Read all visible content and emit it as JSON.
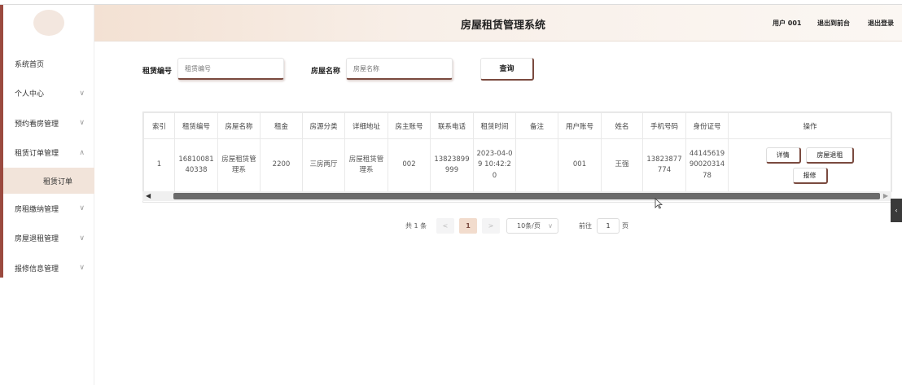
{
  "header": {
    "title": "房屋租赁管理系统",
    "user": "用户 001",
    "back_link": "退出到前台",
    "logout_link": "退出登录"
  },
  "sidebar": {
    "items": [
      {
        "label": "系统首页",
        "chev": ""
      },
      {
        "label": "个人中心",
        "chev": "∨"
      },
      {
        "label": "预约看房管理",
        "chev": "∨"
      },
      {
        "label": "租赁订单管理",
        "chev": "∧"
      },
      {
        "label": "租赁订单",
        "chev": ""
      },
      {
        "label": "房租缴纳管理",
        "chev": "∨"
      },
      {
        "label": "房屋退租管理",
        "chev": "∨"
      },
      {
        "label": "报修信息管理",
        "chev": "∨"
      }
    ]
  },
  "search": {
    "lease_label": "租赁编号",
    "lease_placeholder": "租赁编号",
    "house_label": "房屋名称",
    "house_placeholder": "房屋名称",
    "button": "查询"
  },
  "table": {
    "headers": [
      "索引",
      "租赁编号",
      "房屋名称",
      "租金",
      "房源分类",
      "详细地址",
      "房主账号",
      "联系电话",
      "租赁时间",
      "备注",
      "用户账号",
      "姓名",
      "手机号码",
      "身份证号",
      "操作"
    ],
    "rows": [
      {
        "index": "1",
        "lease_no": "1681008140338",
        "house_name": "房屋租赁管理系",
        "rent": "2200",
        "category": "三房两厅",
        "address": "房屋租赁管理系",
        "owner": "002",
        "phone": "13823899999",
        "time": "2023-04-09 10:42:20",
        "note": "",
        "user": "001",
        "name": "王强",
        "mobile": "13823877774",
        "id_card": "441456199002031478",
        "actions": [
          "详情",
          "房屋退租",
          "报修"
        ]
      }
    ]
  },
  "pagination": {
    "total": "共 1 条",
    "prev": "<",
    "current": "1",
    "next": ">",
    "page_size": "10条/页",
    "goto_label": "前往",
    "goto_value": "1",
    "page_suffix": "页"
  },
  "icons": {
    "chevron_down": "∨",
    "side_toggle": "‹"
  },
  "colors": {
    "accent": "#7a4a3f",
    "header_bg": "#f3e1d3",
    "active_bg": "#f2e4da"
  }
}
